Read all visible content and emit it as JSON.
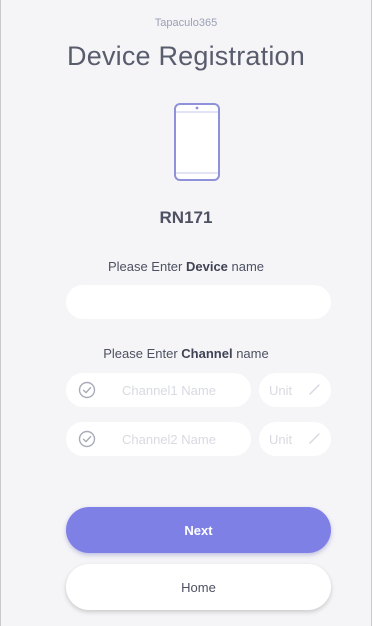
{
  "app": {
    "name": "Tapaculo365",
    "title": "Device Registration"
  },
  "device": {
    "id": "RN171",
    "label_prefix": "Please Enter ",
    "label_bold": "Device",
    "label_suffix": " name",
    "input_value": "",
    "input_placeholder": ""
  },
  "channels": {
    "label_prefix": "Please Enter ",
    "label_bold": "Channel",
    "label_suffix": " name",
    "rows": [
      {
        "name_placeholder": "Channel1 Name",
        "unit_placeholder": "Unit"
      },
      {
        "name_placeholder": "Channel2 Name",
        "unit_placeholder": "Unit"
      }
    ]
  },
  "buttons": {
    "next_label": "Next",
    "home_label": "Home"
  },
  "icons": {
    "device": "smartphone-icon",
    "check": "check-circle-icon",
    "edit": "pencil-icon"
  },
  "colors": {
    "accent": "#7f80e6",
    "background": "#f5f5f7",
    "icon_stroke": "#8f92d8"
  }
}
